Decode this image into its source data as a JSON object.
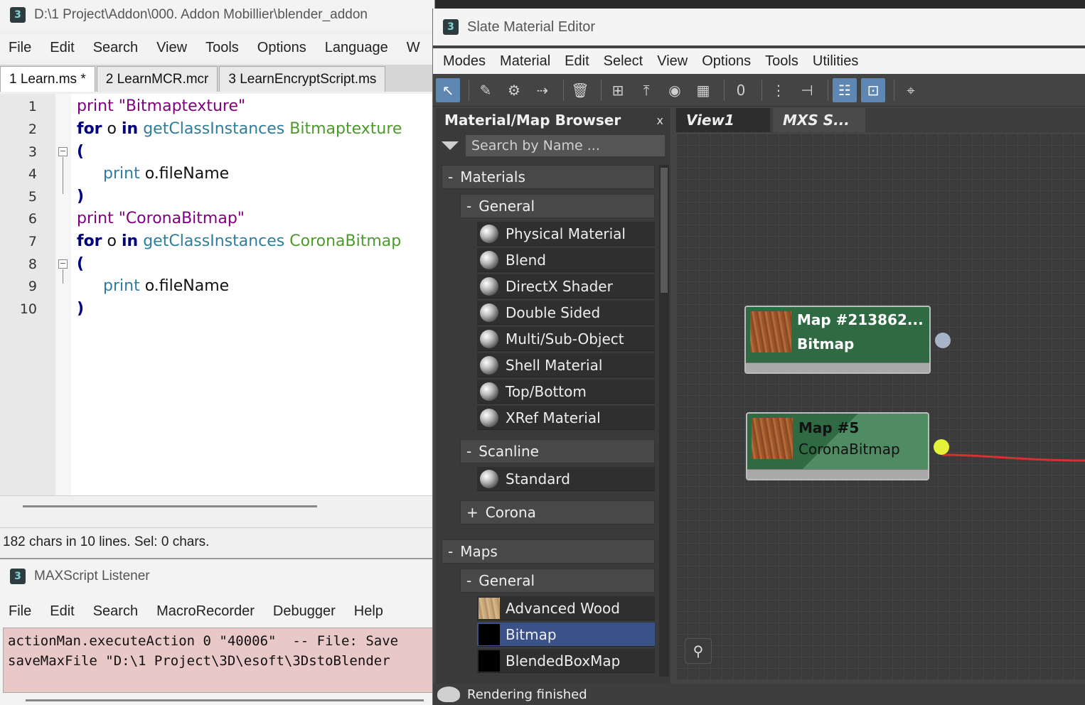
{
  "editor": {
    "title": "D:\\1 Project\\Addon\\000. Addon Mobillier\\blender_addon",
    "app_icon": "3",
    "menu": [
      "File",
      "Edit",
      "Search",
      "View",
      "Tools",
      "Options",
      "Language",
      "W"
    ],
    "tabs": [
      "1 Learn.ms *",
      "2 LearnMCR.mcr",
      "3 LearnEncryptScript.ms"
    ],
    "line_numbers": [
      "1",
      "2",
      "3",
      "4",
      "5",
      "6",
      "7",
      "8",
      "9",
      "10"
    ],
    "code": {
      "l1_fn": "print",
      "l1_str": "\"Bitmaptexture\"",
      "l2_for": "for",
      "l2_var": "o",
      "l2_in": "in",
      "l2_fn": "getClassInstances",
      "l2_type": "Bitmaptexture",
      "l3": "(",
      "l4_fn": "print",
      "l4_rest": "o.fileName",
      "l5": ")",
      "l6_fn": "print",
      "l6_str": "\"CoronaBitmap\"",
      "l7_for": "for",
      "l7_var": "o",
      "l7_in": "in",
      "l7_fn": "getClassInstances",
      "l7_type": "CoronaBitmap",
      "l8": "(",
      "l9_fn": "print",
      "l9_rest": "o.fileName",
      "l10": ")"
    },
    "status": "182 chars in 10 lines. Sel: 0 chars."
  },
  "listener": {
    "title": "MAXScript Listener",
    "app_icon": "3",
    "menu": [
      "File",
      "Edit",
      "Search",
      "MacroRecorder",
      "Debugger",
      "Help"
    ],
    "output": [
      "actionMan.executeAction 0 \"40006\"  -- File: Save",
      "saveMaxFile \"D:\\1 Project\\3D\\esoft\\3DstoBlender"
    ]
  },
  "slate": {
    "title": "Slate Material Editor",
    "app_icon": "3",
    "menu": [
      "Modes",
      "Material",
      "Edit",
      "Select",
      "View",
      "Options",
      "Tools",
      "Utilities"
    ],
    "toolbar": {
      "select_icon": "↖",
      "eyedropper_icon": "✎",
      "pick_icon": "⚙",
      "assign_icon": "⇢",
      "delete_icon": "🗑",
      "layout_icon": "⊞",
      "move_children_icon": "⤒",
      "show_shaded_icon": "◉",
      "bg_icon": "▦",
      "map_zero_icon": "0",
      "layout_all_icon": "⋮",
      "hide_icon": "⊣",
      "nav_icon": "☷",
      "params_icon": "⊡",
      "find_icon": "⌖"
    },
    "browser": {
      "title": "Material/Map Browser",
      "close": "x",
      "search_placeholder": "Search by Name ...",
      "groups": {
        "materials": "Materials",
        "mat_general": "General",
        "scanline": "Scanline",
        "corona": "Corona",
        "maps": "Maps",
        "map_general": "General"
      },
      "signs": {
        "minus": "-",
        "plus": "+"
      },
      "material_items": [
        "Physical Material",
        "Blend",
        "DirectX Shader",
        "Double Sided",
        "Multi/Sub-Object",
        "Shell Material",
        "Top/Bottom",
        "XRef Material"
      ],
      "scanline_items": [
        "Standard"
      ],
      "map_items": [
        "Advanced Wood",
        "Bitmap",
        "BlendedBoxMap"
      ],
      "selected_item": "Bitmap"
    },
    "view_tabs": [
      "View1",
      "MXS S..."
    ],
    "nodes": [
      {
        "line1": "Map #213862...",
        "line2": "Bitmap",
        "port_color": "#a8b4c8"
      },
      {
        "line1": "Map #5",
        "line2": "CoronaBitmap",
        "port_color": "#e6f23a"
      }
    ],
    "wire_color": "#d83030",
    "binoculars_icon": "⚲",
    "status": "Rendering finished"
  }
}
